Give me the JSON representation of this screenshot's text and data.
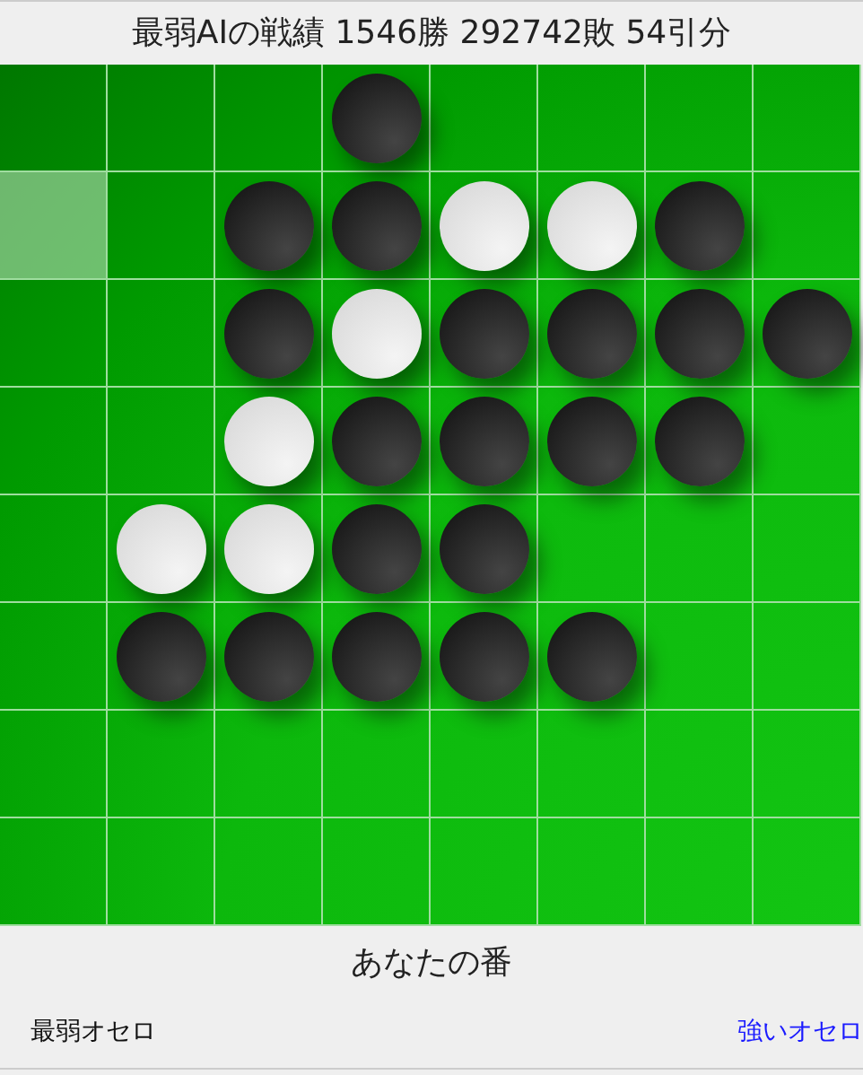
{
  "header": {
    "title": "最弱AIの戦績 1546勝 292742敗 54引分"
  },
  "board": {
    "rows": [
      [
        {
          "kind": "empty"
        },
        {
          "kind": "empty"
        },
        {
          "kind": "empty"
        },
        {
          "kind": "black"
        },
        {
          "kind": "empty"
        },
        {
          "kind": "empty"
        },
        {
          "kind": "empty"
        },
        {
          "kind": "empty"
        }
      ],
      [
        {
          "kind": "hint"
        },
        {
          "kind": "empty"
        },
        {
          "kind": "black"
        },
        {
          "kind": "black"
        },
        {
          "kind": "white"
        },
        {
          "kind": "white"
        },
        {
          "kind": "black"
        },
        {
          "kind": "empty"
        }
      ],
      [
        {
          "kind": "empty"
        },
        {
          "kind": "empty"
        },
        {
          "kind": "black"
        },
        {
          "kind": "white"
        },
        {
          "kind": "black"
        },
        {
          "kind": "black"
        },
        {
          "kind": "black"
        },
        {
          "kind": "black"
        }
      ],
      [
        {
          "kind": "empty"
        },
        {
          "kind": "empty"
        },
        {
          "kind": "white"
        },
        {
          "kind": "black"
        },
        {
          "kind": "black"
        },
        {
          "kind": "black"
        },
        {
          "kind": "black"
        },
        {
          "kind": "empty"
        }
      ],
      [
        {
          "kind": "empty"
        },
        {
          "kind": "white"
        },
        {
          "kind": "white"
        },
        {
          "kind": "black"
        },
        {
          "kind": "black"
        },
        {
          "kind": "empty"
        },
        {
          "kind": "empty"
        },
        {
          "kind": "empty"
        }
      ],
      [
        {
          "kind": "empty"
        },
        {
          "kind": "black"
        },
        {
          "kind": "black"
        },
        {
          "kind": "black"
        },
        {
          "kind": "black"
        },
        {
          "kind": "black"
        },
        {
          "kind": "empty"
        },
        {
          "kind": "empty"
        }
      ],
      [
        {
          "kind": "empty"
        },
        {
          "kind": "empty"
        },
        {
          "kind": "empty"
        },
        {
          "kind": "empty"
        },
        {
          "kind": "empty"
        },
        {
          "kind": "empty"
        },
        {
          "kind": "empty"
        },
        {
          "kind": "empty"
        }
      ],
      [
        {
          "kind": "empty"
        },
        {
          "kind": "empty"
        },
        {
          "kind": "empty"
        },
        {
          "kind": "empty"
        },
        {
          "kind": "empty"
        },
        {
          "kind": "empty"
        },
        {
          "kind": "empty"
        },
        {
          "kind": "empty"
        }
      ]
    ]
  },
  "status": {
    "text": "あなたの番"
  },
  "footer": {
    "links": [
      {
        "label": "最弱オセロ",
        "selected": true
      },
      {
        "label": "強いオセロ",
        "selected": false
      }
    ]
  }
}
